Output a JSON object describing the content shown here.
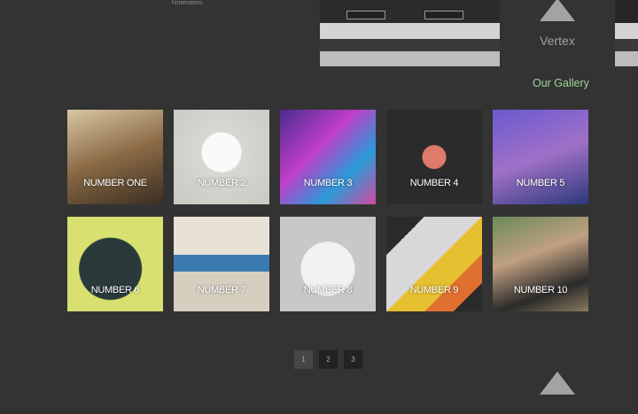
{
  "header": {
    "snippet_text": "himenaeos.",
    "brand": "Vertex",
    "brand_icon": "mountain-icon"
  },
  "gallery": {
    "title": "Our Gallery",
    "title_color": "#9fd49a",
    "items": [
      {
        "label": "NUMBER ONE"
      },
      {
        "label": "NUMBER 2"
      },
      {
        "label": "NUMBER 3"
      },
      {
        "label": "NUMBER 4"
      },
      {
        "label": "NUMBER 5"
      },
      {
        "label": "NUMBER 6"
      },
      {
        "label": "NUMBER 7"
      },
      {
        "label": "NUMBER 8"
      },
      {
        "label": "NUMBER 9"
      },
      {
        "label": "NUMBER 10"
      }
    ]
  },
  "pagination": {
    "pages": [
      "1",
      "2",
      "3"
    ],
    "current": "1"
  },
  "footer": {
    "logo_icon": "mountain-icon"
  }
}
